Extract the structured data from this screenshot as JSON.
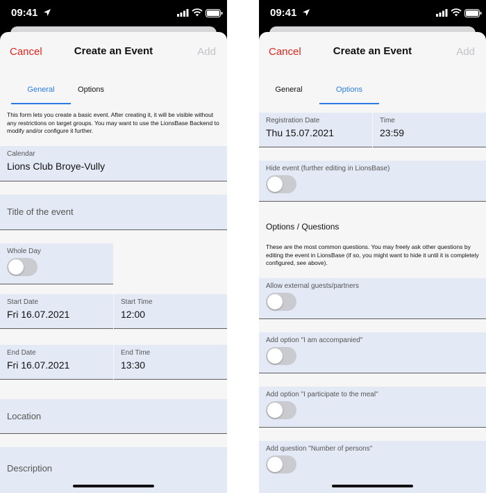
{
  "status_bar": {
    "time": "09:41"
  },
  "nav": {
    "cancel": "Cancel",
    "title": "Create an Event",
    "add": "Add"
  },
  "tabs": [
    "General",
    "Options"
  ],
  "general": {
    "intro": "This form lets you create a basic event. After creating it, it will be visible without any restrictions on target groups. You may want to use the LionsBase Backend to modify and/or configure it further.",
    "calendar": {
      "label": "Calendar",
      "value": "Lions Club Broye-Vully"
    },
    "title_placeholder": "Title of the event",
    "whole_day": {
      "label": "Whole Day",
      "on": false
    },
    "start_date": {
      "label": "Start Date",
      "value": "Fri 16.07.2021"
    },
    "start_time": {
      "label": "Start Time",
      "value": "12:00"
    },
    "end_date": {
      "label": "End Date",
      "value": "Fri 16.07.2021"
    },
    "end_time": {
      "label": "End Time",
      "value": "13:30"
    },
    "location_placeholder": "Location",
    "description_placeholder": "Description"
  },
  "options": {
    "registration_date": {
      "label": "Registration Date",
      "value": "Thu 15.07.2021"
    },
    "time": {
      "label": "Time",
      "value": "23:59"
    },
    "hide_event": {
      "label": "Hide event (further editing in LionsBase)",
      "on": false
    },
    "section_title": "Options / Questions",
    "section_intro": "These are the most common questions. You may freely ask other questions by editing the event in LionsBase (if so, you might want to hide it until it is completely configured, see above).",
    "allow_guests": {
      "label": "Allow external guests/partners",
      "on": false
    },
    "accompanied": {
      "label": "Add option \"I am accompanied\"",
      "on": false
    },
    "meal": {
      "label": "Add option \"I participate to the meal\"",
      "on": false
    },
    "persons": {
      "label": "Add question \"Number of persons\"",
      "on": false
    }
  },
  "colors": {
    "accent": "#2c7be5",
    "cancel": "#e0251c",
    "field_bg": "#e3eaf5",
    "toggle_off": "#c9cbd0"
  },
  "icons": [
    "location-arrow-icon",
    "cellular-signal-icon",
    "wifi-icon",
    "battery-icon"
  ]
}
